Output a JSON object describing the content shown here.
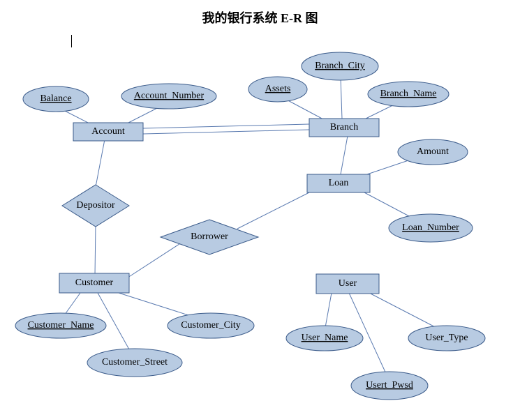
{
  "title": "我的银行系统 E-R 图",
  "entities": {
    "account": "Account",
    "branch": "Branch",
    "loan": "Loan",
    "customer": "Customer",
    "user": "User"
  },
  "relationships": {
    "depositor": "Depositor",
    "borrower": "Borrower"
  },
  "attributes": {
    "balance": "Balance",
    "account_number": "Account_Number",
    "assets": "Assets",
    "branch_city": "Branch_City",
    "branch_name": "Branch_Name",
    "amount": "Amount",
    "loan_number": "Loan_Number",
    "customer_name": "Customer_Name",
    "customer_city": "Customer_City",
    "customer_street": "Customer_Street",
    "user_name": "User_Name",
    "user_type": "User_Type",
    "usert_pwsd": "Usert_Pwsd"
  }
}
